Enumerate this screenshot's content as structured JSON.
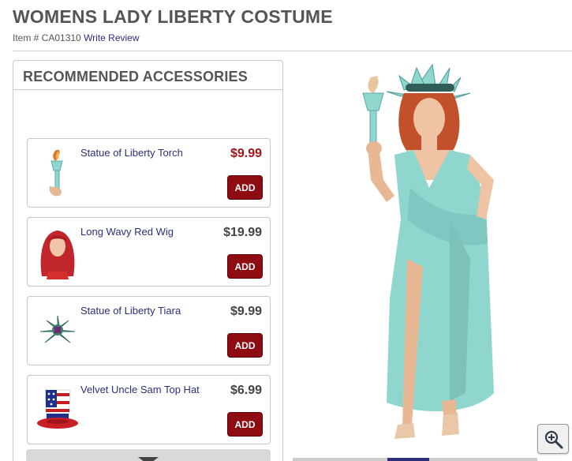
{
  "product": {
    "title": "WOMENS LADY LIBERTY COSTUME",
    "item_label": "Item # CA01310",
    "review_link": "Write Review"
  },
  "accessories": {
    "heading": "RECOMMENDED ACCESSORIES",
    "items": [
      {
        "name": "Statue of Liberty Torch",
        "price": "$9.99",
        "add": "ADD",
        "icon": "torch-icon"
      },
      {
        "name": "Long Wavy Red Wig",
        "price": "$19.99",
        "add": "ADD",
        "icon": "wig-icon"
      },
      {
        "name": "Statue of Liberty Tiara",
        "price": "$9.99",
        "add": "ADD",
        "icon": "tiara-icon"
      },
      {
        "name": "Velvet Uncle Sam Top Hat",
        "price": "$6.99",
        "add": "ADD",
        "icon": "top-hat-icon"
      }
    ]
  },
  "colors": {
    "brand": "#8e0b12",
    "link": "#2d2f7e",
    "sale_price": "#a0141c",
    "costume": "#8fd6cf"
  }
}
